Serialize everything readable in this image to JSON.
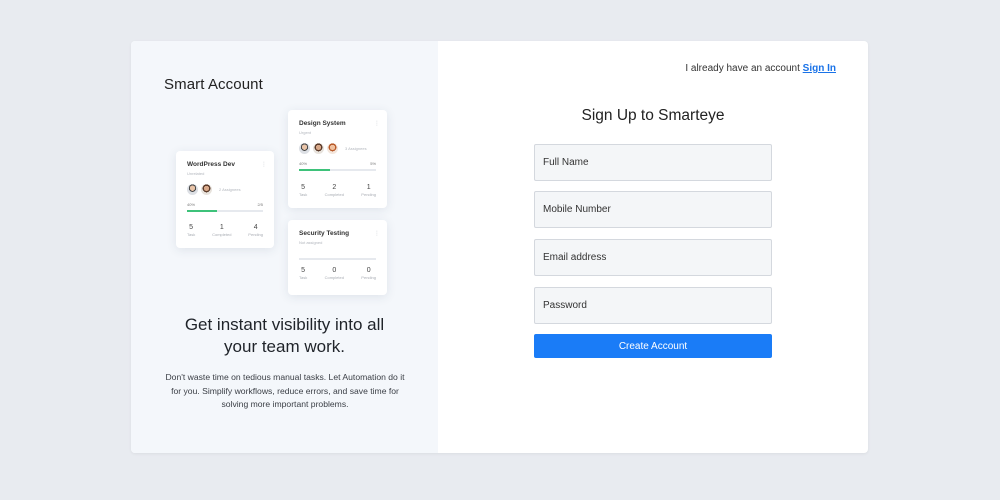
{
  "left": {
    "brand": "Smart Account",
    "headline": "Get instant visibility into all your team work.",
    "description": "Don't waste time on tedious manual tasks. Let Automation do it for you. Simplify workflows, reduce errors, and save time for solving more important problems."
  },
  "mini_cards": [
    {
      "title": "WordPress Dev",
      "subtitle": "Unrelated",
      "assign_text": "2 Assignees",
      "progress_left": "40%",
      "progress_right": "2/5",
      "progress": 0.4,
      "stats": [
        {
          "num": "5",
          "label": "Task"
        },
        {
          "num": "1",
          "label": "Completed"
        },
        {
          "num": "4",
          "label": "Pending"
        }
      ]
    },
    {
      "title": "Design System",
      "subtitle": "Urgent",
      "assign_text": "3 Assignees",
      "progress_left": "40%",
      "progress_right": "5%",
      "progress": 0.4,
      "stats": [
        {
          "num": "5",
          "label": "Task"
        },
        {
          "num": "2",
          "label": "Completed"
        },
        {
          "num": "1",
          "label": "Pending"
        }
      ]
    },
    {
      "title": "Security Testing",
      "subtitle": "Not assigned",
      "progress": 0.0,
      "stats": [
        {
          "num": "5",
          "label": "Task"
        },
        {
          "num": "0",
          "label": "Completed"
        },
        {
          "num": "0",
          "label": "Pending"
        }
      ]
    }
  ],
  "right": {
    "already_text": "I already have an account",
    "signin_link": "Sign In",
    "title": "Sign Up to Smarteye",
    "fields": {
      "full_name": "Full Name",
      "mobile": "Mobile Number",
      "email": "Email address",
      "password": "Password"
    },
    "create_button": "Create Account"
  },
  "colors": {
    "accent": "#1a7cf7",
    "link": "#1a73e8",
    "left_panel": "#f4f7fb",
    "page_bg": "#e8ebf0",
    "progress": "#3ec27a"
  }
}
